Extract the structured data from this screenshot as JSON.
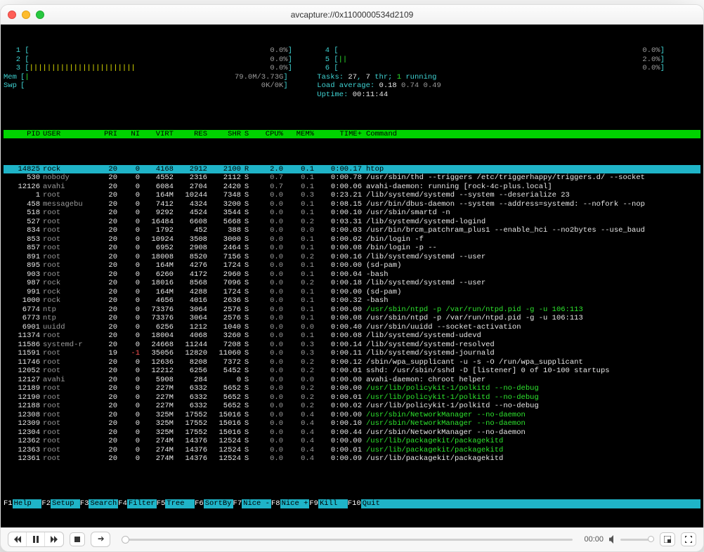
{
  "window": {
    "title": "avcapture://0x1100000534d2109"
  },
  "cpus_left": [
    {
      "id": "1",
      "bar": "",
      "pct": "0.0%"
    },
    {
      "id": "2",
      "bar": "",
      "pct": "0.0%"
    },
    {
      "id": "3",
      "bar": "||||||||||||||||||||||||",
      "pct": "0.0%"
    }
  ],
  "cpus_right": [
    {
      "id": "4",
      "bar": "",
      "pct": "0.0%"
    },
    {
      "id": "5",
      "bar": "||",
      "pct": "2.0%"
    },
    {
      "id": "6",
      "bar": "",
      "pct": "0.0%"
    }
  ],
  "mem": {
    "label": "Mem",
    "bar": "|",
    "val": "79.0M/3.73G"
  },
  "swp": {
    "label": "Swp",
    "bar": "",
    "val": "0K/0K"
  },
  "tasks_line": "Tasks: 27, 7 thr; 1 running",
  "load_line": "Load average: 0.18 0.74 0.49",
  "uptime_line": "Uptime: 00:11:44",
  "columns": [
    "PID",
    "USER",
    "PRI",
    "NI",
    "VIRT",
    "RES",
    "SHR",
    "S",
    "CPU%",
    "MEM%",
    "TIME+",
    "Command"
  ],
  "processes": [
    {
      "pid": "14825",
      "user": "rock",
      "pri": "20",
      "ni": "0",
      "virt": "4168",
      "res": "2912",
      "shr": "2100",
      "s": "R",
      "cpu": "2.0",
      "mem": "0.1",
      "time": "0:00.17",
      "cmd": "htop",
      "sel": true
    },
    {
      "pid": "530",
      "user": "nobody",
      "pri": "20",
      "ni": "0",
      "virt": "4552",
      "res": "2316",
      "shr": "2112",
      "s": "S",
      "cpu": "0.7",
      "mem": "0.1",
      "time": "0:00.78",
      "cmd": "/usr/sbin/thd --triggers /etc/triggerhappy/triggers.d/ --socket"
    },
    {
      "pid": "12126",
      "user": "avahi",
      "pri": "20",
      "ni": "0",
      "virt": "6084",
      "res": "2704",
      "shr": "2420",
      "s": "S",
      "cpu": "0.7",
      "mem": "0.1",
      "time": "0:00.06",
      "cmd": "avahi-daemon: running [rock-4c-plus.local]"
    },
    {
      "pid": "1",
      "user": "root",
      "pri": "20",
      "ni": "0",
      "virt": "164M",
      "res": "10244",
      "shr": "7348",
      "s": "S",
      "cpu": "0.0",
      "mem": "0.3",
      "time": "0:23.21",
      "cmd": "/lib/systemd/systemd --system --deserialize 23"
    },
    {
      "pid": "458",
      "user": "messagebu",
      "pri": "20",
      "ni": "0",
      "virt": "7412",
      "res": "4324",
      "shr": "3200",
      "s": "S",
      "cpu": "0.0",
      "mem": "0.1",
      "time": "0:08.15",
      "cmd": "/usr/bin/dbus-daemon --system --address=systemd: --nofork --nop"
    },
    {
      "pid": "518",
      "user": "root",
      "pri": "20",
      "ni": "0",
      "virt": "9292",
      "res": "4524",
      "shr": "3544",
      "s": "S",
      "cpu": "0.0",
      "mem": "0.1",
      "time": "0:00.10",
      "cmd": "/usr/sbin/smartd -n"
    },
    {
      "pid": "527",
      "user": "root",
      "pri": "20",
      "ni": "0",
      "virt": "16484",
      "res": "6608",
      "shr": "5668",
      "s": "S",
      "cpu": "0.0",
      "mem": "0.2",
      "time": "0:03.31",
      "cmd": "/lib/systemd/systemd-logind"
    },
    {
      "pid": "834",
      "user": "root",
      "pri": "20",
      "ni": "0",
      "virt": "1792",
      "res": "452",
      "shr": "388",
      "s": "S",
      "cpu": "0.0",
      "mem": "0.0",
      "time": "0:00.03",
      "cmd": "/usr/bin/brcm_patchram_plus1 --enable_hci --no2bytes --use_baud"
    },
    {
      "pid": "853",
      "user": "root",
      "pri": "20",
      "ni": "0",
      "virt": "10924",
      "res": "3508",
      "shr": "3000",
      "s": "S",
      "cpu": "0.0",
      "mem": "0.1",
      "time": "0:00.02",
      "cmd": "/bin/login -f"
    },
    {
      "pid": "857",
      "user": "root",
      "pri": "20",
      "ni": "0",
      "virt": "6952",
      "res": "2908",
      "shr": "2464",
      "s": "S",
      "cpu": "0.0",
      "mem": "0.1",
      "time": "0:00.08",
      "cmd": "/bin/login -p --"
    },
    {
      "pid": "891",
      "user": "root",
      "pri": "20",
      "ni": "0",
      "virt": "18008",
      "res": "8520",
      "shr": "7156",
      "s": "S",
      "cpu": "0.0",
      "mem": "0.2",
      "time": "0:00.16",
      "cmd": "/lib/systemd/systemd --user"
    },
    {
      "pid": "895",
      "user": "root",
      "pri": "20",
      "ni": "0",
      "virt": "164M",
      "res": "4276",
      "shr": "1724",
      "s": "S",
      "cpu": "0.0",
      "mem": "0.1",
      "time": "0:00.00",
      "cmd": "(sd-pam)"
    },
    {
      "pid": "903",
      "user": "root",
      "pri": "20",
      "ni": "0",
      "virt": "6260",
      "res": "4172",
      "shr": "2960",
      "s": "S",
      "cpu": "0.0",
      "mem": "0.1",
      "time": "0:00.04",
      "cmd": "-bash"
    },
    {
      "pid": "987",
      "user": "rock",
      "pri": "20",
      "ni": "0",
      "virt": "18016",
      "res": "8568",
      "shr": "7096",
      "s": "S",
      "cpu": "0.0",
      "mem": "0.2",
      "time": "0:00.18",
      "cmd": "/lib/systemd/systemd --user"
    },
    {
      "pid": "991",
      "user": "rock",
      "pri": "20",
      "ni": "0",
      "virt": "164M",
      "res": "4288",
      "shr": "1724",
      "s": "S",
      "cpu": "0.0",
      "mem": "0.1",
      "time": "0:00.00",
      "cmd": "(sd-pam)"
    },
    {
      "pid": "1000",
      "user": "rock",
      "pri": "20",
      "ni": "0",
      "virt": "4656",
      "res": "4016",
      "shr": "2636",
      "s": "S",
      "cpu": "0.0",
      "mem": "0.1",
      "time": "0:00.32",
      "cmd": "-bash"
    },
    {
      "pid": "6774",
      "user": "ntp",
      "pri": "20",
      "ni": "0",
      "virt": "73376",
      "res": "3064",
      "shr": "2576",
      "s": "S",
      "cpu": "0.0",
      "mem": "0.1",
      "time": "0:00.00",
      "cmd": "/usr/sbin/ntpd -p /var/run/ntpd.pid -g -u 106:113",
      "dim": true
    },
    {
      "pid": "6773",
      "user": "ntp",
      "pri": "20",
      "ni": "0",
      "virt": "73376",
      "res": "3064",
      "shr": "2576",
      "s": "S",
      "cpu": "0.0",
      "mem": "0.1",
      "time": "0:00.08",
      "cmd": "/usr/sbin/ntpd -p /var/run/ntpd.pid -g -u 106:113"
    },
    {
      "pid": "6901",
      "user": "uuidd",
      "pri": "20",
      "ni": "0",
      "virt": "6256",
      "res": "1212",
      "shr": "1040",
      "s": "S",
      "cpu": "0.0",
      "mem": "0.0",
      "time": "0:00.40",
      "cmd": "/usr/sbin/uuidd --socket-activation"
    },
    {
      "pid": "11374",
      "user": "root",
      "pri": "20",
      "ni": "0",
      "virt": "18004",
      "res": "4068",
      "shr": "3260",
      "s": "S",
      "cpu": "0.0",
      "mem": "0.1",
      "time": "0:00.08",
      "cmd": "/lib/systemd/systemd-udevd"
    },
    {
      "pid": "11586",
      "user": "systemd-r",
      "pri": "20",
      "ni": "0",
      "virt": "24668",
      "res": "11244",
      "shr": "7208",
      "s": "S",
      "cpu": "0.0",
      "mem": "0.3",
      "time": "0:00.14",
      "cmd": "/lib/systemd/systemd-resolved"
    },
    {
      "pid": "11591",
      "user": "root",
      "pri": "19",
      "ni": "-1",
      "virt": "35056",
      "res": "12820",
      "shr": "11060",
      "s": "S",
      "cpu": "0.0",
      "mem": "0.3",
      "time": "0:00.11",
      "cmd": "/lib/systemd/systemd-journald",
      "nired": true
    },
    {
      "pid": "11746",
      "user": "root",
      "pri": "20",
      "ni": "0",
      "virt": "12636",
      "res": "8208",
      "shr": "7372",
      "s": "S",
      "cpu": "0.0",
      "mem": "0.2",
      "time": "0:00.12",
      "cmd": "/sbin/wpa_supplicant -u -s -O /run/wpa_supplicant"
    },
    {
      "pid": "12052",
      "user": "root",
      "pri": "20",
      "ni": "0",
      "virt": "12212",
      "res": "6256",
      "shr": "5452",
      "s": "S",
      "cpu": "0.0",
      "mem": "0.2",
      "time": "0:00.01",
      "cmd": "sshd: /usr/sbin/sshd -D [listener] 0 of 10-100 startups"
    },
    {
      "pid": "12127",
      "user": "avahi",
      "pri": "20",
      "ni": "0",
      "virt": "5908",
      "res": "284",
      "shr": "0",
      "s": "S",
      "cpu": "0.0",
      "mem": "0.0",
      "time": "0:00.00",
      "cmd": "avahi-daemon: chroot helper"
    },
    {
      "pid": "12189",
      "user": "root",
      "pri": "20",
      "ni": "0",
      "virt": "227M",
      "res": "6332",
      "shr": "5652",
      "s": "S",
      "cpu": "0.0",
      "mem": "0.2",
      "time": "0:00.00",
      "cmd": "/usr/lib/policykit-1/polkitd --no-debug",
      "dim": true
    },
    {
      "pid": "12190",
      "user": "root",
      "pri": "20",
      "ni": "0",
      "virt": "227M",
      "res": "6332",
      "shr": "5652",
      "s": "S",
      "cpu": "0.0",
      "mem": "0.2",
      "time": "0:00.01",
      "cmd": "/usr/lib/policykit-1/polkitd --no-debug",
      "dim": true
    },
    {
      "pid": "12188",
      "user": "root",
      "pri": "20",
      "ni": "0",
      "virt": "227M",
      "res": "6332",
      "shr": "5652",
      "s": "S",
      "cpu": "0.0",
      "mem": "0.2",
      "time": "0:00.02",
      "cmd": "/usr/lib/policykit-1/polkitd --no-debug"
    },
    {
      "pid": "12308",
      "user": "root",
      "pri": "20",
      "ni": "0",
      "virt": "325M",
      "res": "17552",
      "shr": "15016",
      "s": "S",
      "cpu": "0.0",
      "mem": "0.4",
      "time": "0:00.00",
      "cmd": "/usr/sbin/NetworkManager --no-daemon",
      "dim": true
    },
    {
      "pid": "12309",
      "user": "root",
      "pri": "20",
      "ni": "0",
      "virt": "325M",
      "res": "17552",
      "shr": "15016",
      "s": "S",
      "cpu": "0.0",
      "mem": "0.4",
      "time": "0:00.10",
      "cmd": "/usr/sbin/NetworkManager --no-daemon",
      "dim": true
    },
    {
      "pid": "12304",
      "user": "root",
      "pri": "20",
      "ni": "0",
      "virt": "325M",
      "res": "17552",
      "shr": "15016",
      "s": "S",
      "cpu": "0.0",
      "mem": "0.4",
      "time": "0:00.44",
      "cmd": "/usr/sbin/NetworkManager --no-daemon"
    },
    {
      "pid": "12362",
      "user": "root",
      "pri": "20",
      "ni": "0",
      "virt": "274M",
      "res": "14376",
      "shr": "12524",
      "s": "S",
      "cpu": "0.0",
      "mem": "0.4",
      "time": "0:00.00",
      "cmd": "/usr/lib/packagekit/packagekitd",
      "dim": true
    },
    {
      "pid": "12363",
      "user": "root",
      "pri": "20",
      "ni": "0",
      "virt": "274M",
      "res": "14376",
      "shr": "12524",
      "s": "S",
      "cpu": "0.0",
      "mem": "0.4",
      "time": "0:00.01",
      "cmd": "/usr/lib/packagekit/packagekitd",
      "dim": true
    },
    {
      "pid": "12361",
      "user": "root",
      "pri": "20",
      "ni": "0",
      "virt": "274M",
      "res": "14376",
      "shr": "12524",
      "s": "S",
      "cpu": "0.0",
      "mem": "0.4",
      "time": "0:00.09",
      "cmd": "/usr/lib/packagekit/packagekitd"
    }
  ],
  "fkeys": [
    {
      "k": "F1",
      "l": "Help  "
    },
    {
      "k": "F2",
      "l": "Setup "
    },
    {
      "k": "F3",
      "l": "Search"
    },
    {
      "k": "F4",
      "l": "Filter"
    },
    {
      "k": "F5",
      "l": "Tree  "
    },
    {
      "k": "F6",
      "l": "SortBy"
    },
    {
      "k": "F7",
      "l": "Nice -"
    },
    {
      "k": "F8",
      "l": "Nice +"
    },
    {
      "k": "F9",
      "l": "Kill  "
    },
    {
      "k": "F10",
      "l": "Quit  "
    }
  ],
  "playbar": {
    "time": "00:00"
  }
}
